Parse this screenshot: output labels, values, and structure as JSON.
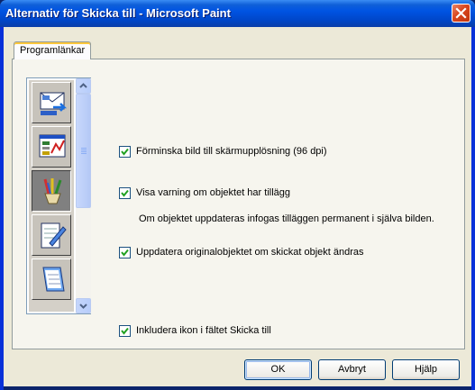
{
  "window": {
    "title": "Alternativ för Skicka till - Microsoft Paint"
  },
  "tabs": [
    {
      "label": "Programlänkar"
    }
  ],
  "icon_list": {
    "items": [
      {
        "icon": "envelope-send-icon"
      },
      {
        "icon": "window-chart-icon"
      },
      {
        "icon": "paint-brushes-icon",
        "selected": true
      },
      {
        "icon": "notepad-pen-icon"
      },
      {
        "icon": "notebook-icon"
      }
    ]
  },
  "options": {
    "reduce": {
      "label": "Förminska bild till skärmupplösning (96 dpi)",
      "checked": true
    },
    "warn": {
      "label": "Visa varning om objektet har tillägg",
      "checked": true
    },
    "warn_note": "Om objektet uppdateras infogas tilläggen permanent i själva bilden.",
    "update": {
      "label": "Uppdatera originalobjektet om skickat objekt ändras",
      "checked": true
    },
    "include_icon": {
      "label": "Inkludera ikon i fältet Skicka till",
      "checked": true
    }
  },
  "buttons": {
    "ok": "OK",
    "cancel": "Avbryt",
    "help": "Hjälp"
  },
  "colors": {
    "titlebar": "#0054e3",
    "face": "#ece9d8",
    "close": "#d9451d"
  }
}
